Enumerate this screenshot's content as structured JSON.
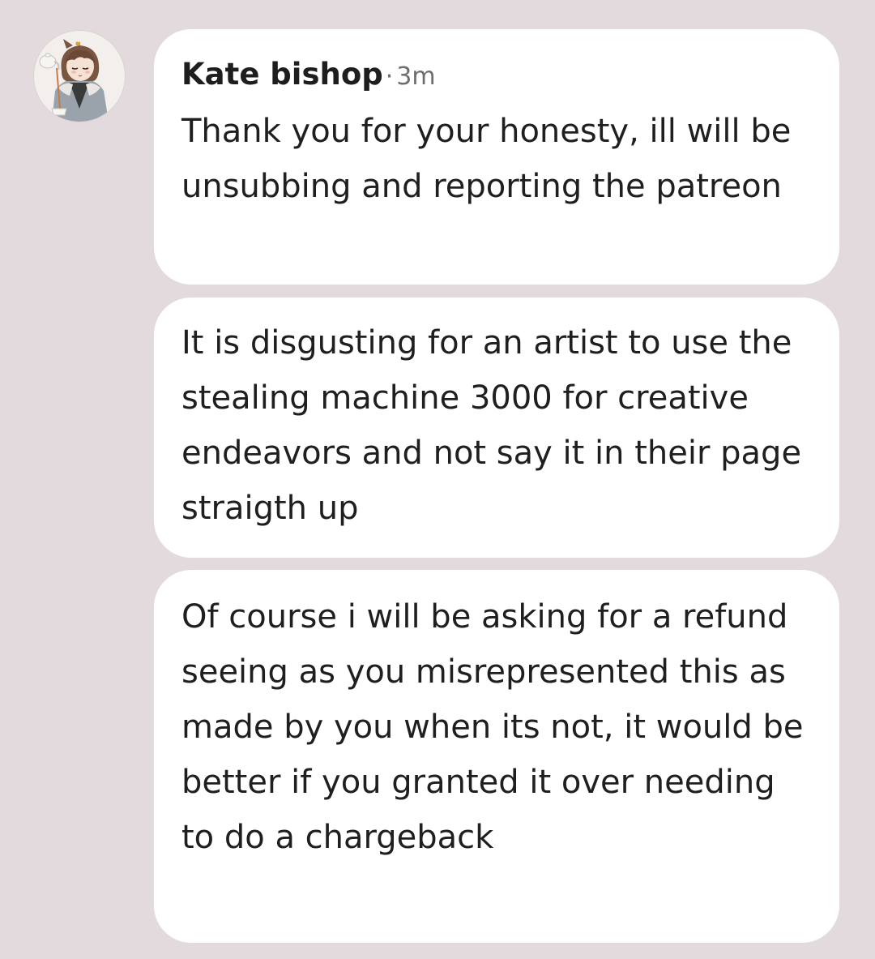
{
  "thread": {
    "author": "Kate bishop",
    "separator": "·",
    "timestamp": "3m",
    "avatar_icon": "avatar-illustration",
    "messages": [
      "Thank you for your honesty, ill will be unsubbing and reporting the patreon",
      "It is disgusting for an artist to use the stealing machine 3000 for creative endeavors and not say it in their page straigth up",
      "Of course i will be asking for a refund seeing as you misrepresented this as made by you when its not, it would be better if you granted it over needing to do a chargeback"
    ]
  },
  "colors": {
    "background": "#e3dadd",
    "bubble": "#ffffff",
    "text": "#1f1f1f",
    "meta_text": "#6e6e6e"
  }
}
